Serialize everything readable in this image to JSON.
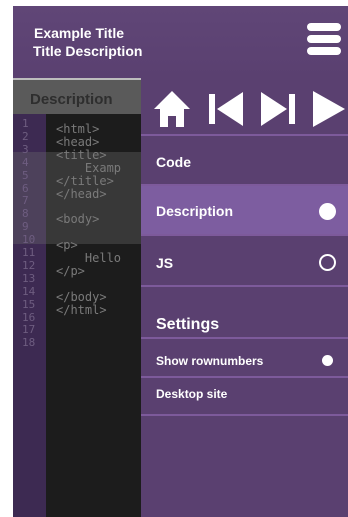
{
  "header": {
    "title": "Example Title",
    "subtitle": "Title Description",
    "menu_icon": "hamburger-icon"
  },
  "code_panel": {
    "tab_label": "Description",
    "line_numbers": [
      "1",
      "2",
      "3",
      "4",
      "5",
      "6",
      "7",
      "8",
      "9",
      "10",
      "11",
      "12",
      "13",
      "14",
      "15",
      "16",
      "17",
      "18"
    ],
    "lines": [
      {
        "line": 1,
        "text": "<html>"
      },
      {
        "line": 2,
        "text": "<head>"
      },
      {
        "line": 3,
        "text": "<title>"
      },
      {
        "line": 4,
        "text": "    Examp"
      },
      {
        "line": 5,
        "text": "</title>"
      },
      {
        "line": 6,
        "text": "</head>"
      },
      {
        "line": 8,
        "text": "<body>"
      },
      {
        "line": 10,
        "text": "<p>"
      },
      {
        "line": 11,
        "text": "    Hello"
      },
      {
        "line": 12,
        "text": "</p>"
      },
      {
        "line": 14,
        "text": "</body>"
      },
      {
        "line": 15,
        "text": "</html>"
      }
    ]
  },
  "nav": {
    "icons": [
      "home-icon",
      "skip-back-icon",
      "skip-forward-icon",
      "play-icon"
    ]
  },
  "menu": {
    "items": [
      {
        "label": "Code",
        "state": "none"
      },
      {
        "label": "Description",
        "state": "selected"
      },
      {
        "label": "JS",
        "state": "unselected"
      }
    ],
    "settings_label": "Settings",
    "show_rownumbers_label": "Show rownumbers",
    "show_rownumbers_on": true,
    "desktop_site_label": "Desktop site"
  },
  "colors": {
    "primary": "#5a4070",
    "active_item": "#7d5da0",
    "divider": "#7d5a9b",
    "gutter": "#3d2a52",
    "code_bg": "#1c1c1c"
  }
}
